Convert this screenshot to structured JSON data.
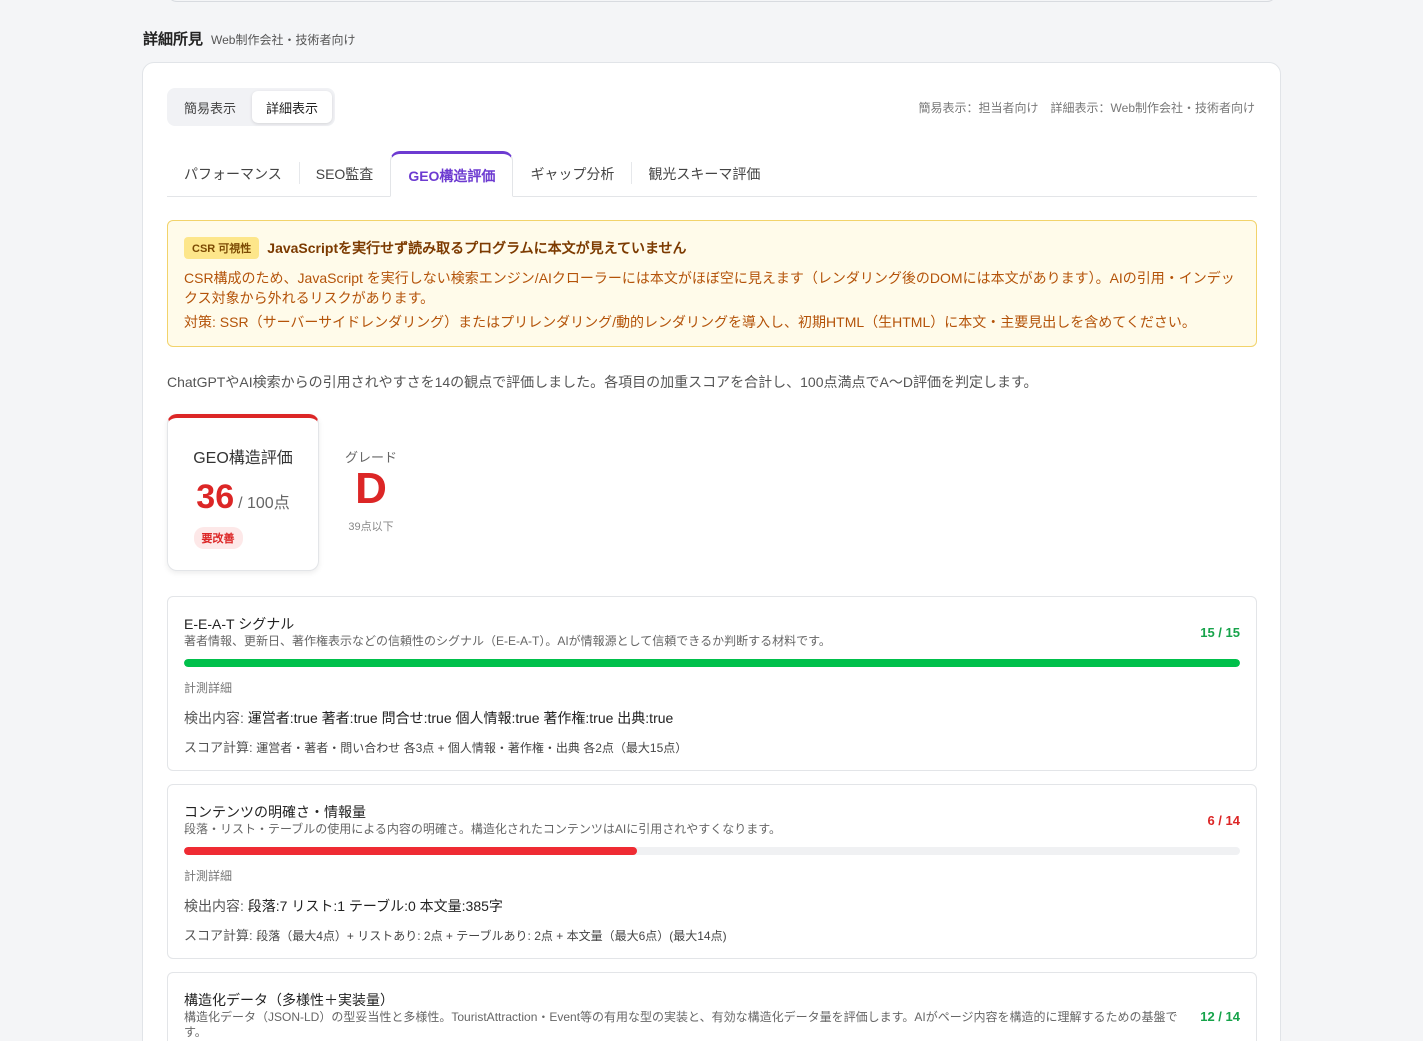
{
  "section": {
    "title": "詳細所見",
    "subtitle": "Web制作会社・技術者向け"
  },
  "view_toggle": {
    "simple": "簡易表示",
    "detail": "詳細表示"
  },
  "view_note": "簡易表示：担当者向け　詳細表示：Web制作会社・技術者向け",
  "tabs": [
    {
      "label": "パフォーマンス"
    },
    {
      "label": "SEO監査"
    },
    {
      "label": "GEO構造評価",
      "active": true
    },
    {
      "label": "ギャップ分析"
    },
    {
      "label": "観光スキーマ評価"
    }
  ],
  "alert": {
    "badge": "CSR 可視性",
    "title": "JavaScriptを実行せず読み取るプログラムに本文が見えていません",
    "body": "CSR構成のため、JavaScript を実行しない検索エンジン/AIクローラーには本文がほぼ空に見えます（レンダリング後のDOMには本文があります）。AIの引用・インデックス対象から外れるリスクがあります。",
    "action": "対策: SSR（サーバーサイドレンダリング）またはプリレンダリング/動的レンダリングを導入し、初期HTML（生HTML）に本文・主要見出しを含めてください。"
  },
  "intro": "ChatGPTやAI検索からの引用されやすさを14の観点で評価しました。各項目の加重スコアを合計し、100点満点でA〜D評価を判定します。",
  "score_card": {
    "label": "GEO構造評価",
    "score": "36",
    "max": "/ 100点",
    "badge": "要改善"
  },
  "grade": {
    "label": "グレード",
    "letter": "D",
    "note": "39点以下"
  },
  "colors": {
    "good": "#16a34a",
    "bad": "#dc2626",
    "good_bar": "#00c04b",
    "bad_bar": "#ef2b33",
    "accent": "#6d3bd1"
  },
  "metrics": [
    {
      "title": "E-E-A-T シグナル",
      "desc": "著者情報、更新日、著作権表示などの信頼性のシグナル（E-E-A-T）。AIが情報源として信頼できるか判断する材料です。",
      "score_text": "15 / 15",
      "score": 15,
      "max": 15,
      "status": "good",
      "detail_label": "計測詳細",
      "detected_label": "検出内容: ",
      "detected": "運営者:true 著者:true 問合せ:true 個人情報:true 著作権:true 出典:true",
      "calc_label": "スコア計算: ",
      "calc": "運営者・著者・問い合わせ  各3点  +  個人情報・著作権・出典  各2点（最大15点）"
    },
    {
      "title": "コンテンツの明確さ・情報量",
      "desc": "段落・リスト・テーブルの使用による内容の明確さ。構造化されたコンテンツはAIに引用されやすくなります。",
      "score_text": "6 / 14",
      "score": 6,
      "max": 14,
      "status": "bad",
      "detail_label": "計測詳細",
      "detected_label": "検出内容: ",
      "detected": "段落:7 リスト:1 テーブル:0 本文量:385字",
      "calc_label": "スコア計算: ",
      "calc": "段落（最大4点）+  リストあり:  2点  +  テーブルあり:  2点  +  本文量（最大6点）(最大14点)"
    },
    {
      "title": "構造化データ（多様性＋実装量）",
      "desc": "構造化データ（JSON-LD）の型妥当性と多様性。TouristAttraction・Event等の有用な型の実装と、有効な構造化データ量を評価します。AIがページ内容を構造的に理解するための基盤です。",
      "score_text": "12 / 14",
      "score": 12,
      "max": 14,
      "status": "good"
    }
  ]
}
